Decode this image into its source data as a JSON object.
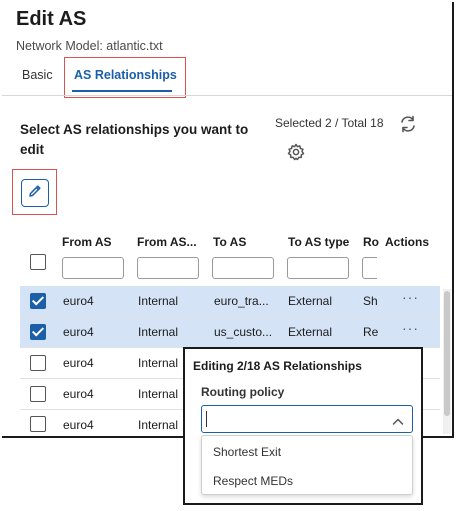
{
  "header": {
    "title": "Edit AS",
    "subtitle": "Network Model: atlantic.txt"
  },
  "tabs": [
    {
      "label": "Basic",
      "active": false
    },
    {
      "label": "AS Relationships",
      "active": true
    }
  ],
  "section": {
    "title": "Select AS relationships you want to edit",
    "selected_count": "Selected 2 / Total 18"
  },
  "icons": {
    "refresh": "refresh-icon",
    "settings": "gear-icon",
    "edit": "pencil-icon",
    "more": "more-horizontal-icon",
    "dropdown": "chevron-up-icon"
  },
  "table": {
    "columns": [
      "From AS",
      "From AS...",
      "To AS",
      "To AS type",
      "Ro",
      "Actions"
    ],
    "rows": [
      {
        "selected": true,
        "from_as": "euro4",
        "from_type": "Internal",
        "to_as": "euro_tra...",
        "to_type": "External",
        "routing": "Sh",
        "actions": "···"
      },
      {
        "selected": true,
        "from_as": "euro4",
        "from_type": "Internal",
        "to_as": "us_custo...",
        "to_type": "External",
        "routing": "Re",
        "actions": "···"
      },
      {
        "selected": false,
        "from_as": "euro4",
        "from_type": "Internal"
      },
      {
        "selected": false,
        "from_as": "euro4",
        "from_type": "Internal"
      },
      {
        "selected": false,
        "from_as": "euro4",
        "from_type": "Internal"
      }
    ]
  },
  "popup": {
    "title": "Editing 2/18 AS Relationships",
    "field_label": "Routing policy",
    "value": "",
    "options": [
      "Shortest Exit",
      "Respect MEDs"
    ]
  },
  "colors": {
    "accent": "#1a5fa8",
    "highlight_border": "#d9534f",
    "selected_row": "#d5e3f7"
  }
}
